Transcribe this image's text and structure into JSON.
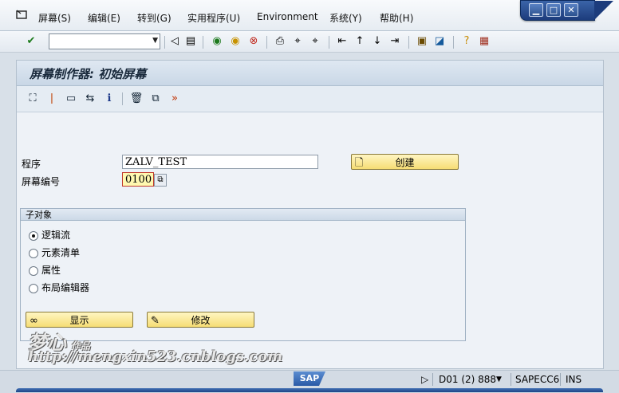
{
  "menu": {
    "items": [
      "屏幕(S)",
      "编辑(E)",
      "转到(G)",
      "实用程序(U)",
      "Environment",
      "系统(Y)",
      "帮助(H)"
    ]
  },
  "toolbar": {
    "command_value": "",
    "icons": [
      "check-icon",
      "back-icon",
      "save-icon",
      "back-green-icon",
      "exit-icon",
      "cancel-icon",
      "print-icon",
      "find-icon",
      "find-next-icon",
      "first-page-icon",
      "prev-page-icon",
      "next-page-icon",
      "last-page-icon",
      "new-session-icon",
      "shortcut-icon",
      "help-icon",
      "layout-icon"
    ]
  },
  "screen": {
    "title": "屏幕制作器: 初始屏幕"
  },
  "form": {
    "program_label": "程序",
    "program_value": "ZALV_TEST",
    "screen_number_label": "屏幕编号",
    "screen_number_value": "0100",
    "create_label": "创建"
  },
  "subobjects": {
    "title": "子对象",
    "options": [
      {
        "label": "逻辑流",
        "selected": true
      },
      {
        "label": "元素清单",
        "selected": false
      },
      {
        "label": "属性",
        "selected": false
      },
      {
        "label": "布局编辑器",
        "selected": false
      }
    ],
    "display_label": "显示",
    "change_label": "修改"
  },
  "watermark": {
    "line1": "梦心",
    "line1_small": "作品",
    "line2": "http://mengxin523.cnblogs.com"
  },
  "status": {
    "logo": "SAP",
    "system": "D01 (2) 888",
    "server": "SAPECC6",
    "mode": "INS"
  },
  "colors": {
    "title_gradient": "#c9d7e6",
    "button_yellow": "#f6dd74",
    "focus_field": "#fff8b0",
    "window_controls": "#1c3c7c"
  }
}
